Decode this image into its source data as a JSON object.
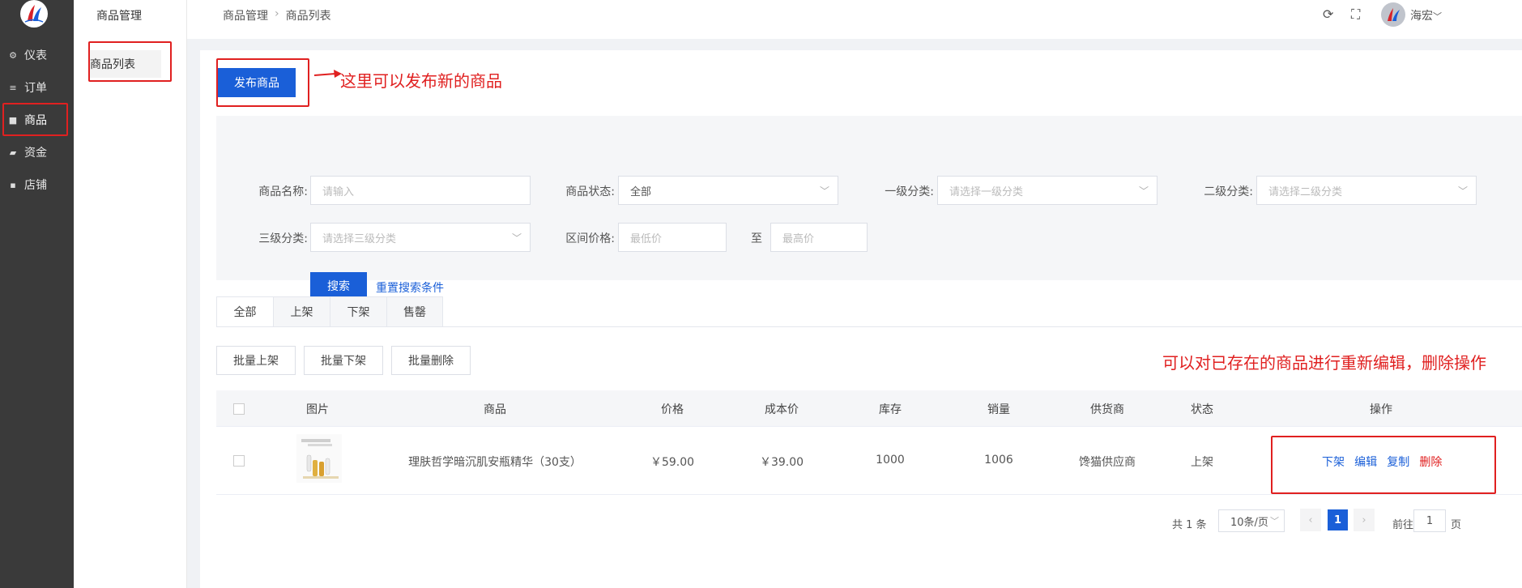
{
  "sidebar": {
    "items": [
      {
        "icon": "gear-icon",
        "label": "仪表"
      },
      {
        "icon": "list-icon",
        "label": "订单"
      },
      {
        "icon": "bag-icon",
        "label": "商品"
      },
      {
        "icon": "wallet-icon",
        "label": "资金"
      },
      {
        "icon": "store-icon",
        "label": "店铺"
      }
    ]
  },
  "submenu": {
    "title": "商品管理",
    "item": "商品列表"
  },
  "header": {
    "breadcrumb": [
      "商品管理",
      "商品列表"
    ],
    "username": "海宏"
  },
  "toolbar": {
    "publish_label": "发布商品"
  },
  "filters": {
    "name_label": "商品名称:",
    "name_placeholder": "请输入",
    "status_label": "商品状态:",
    "status_value": "全部",
    "cat1_label": "一级分类:",
    "cat1_placeholder": "请选择一级分类",
    "cat2_label": "二级分类:",
    "cat2_placeholder": "请选择二级分类",
    "cat3_label": "三级分类:",
    "cat3_placeholder": "请选择三级分类",
    "price_label": "区间价格:",
    "price_min_placeholder": "最低价",
    "price_to": "至",
    "price_max_placeholder": "最高价",
    "search_label": "搜索",
    "reset_label": "重置搜索条件"
  },
  "tabs": [
    "全部",
    "上架",
    "下架",
    "售罄"
  ],
  "bulk": {
    "on": "批量上架",
    "off": "批量下架",
    "delete": "批量删除"
  },
  "table": {
    "columns": [
      "图片",
      "商品",
      "价格",
      "成本价",
      "库存",
      "销量",
      "供货商",
      "状态",
      "操作"
    ],
    "rows": [
      {
        "name": "理肤哲学暗沉肌安瓶精华（30支）",
        "price": "￥59.00",
        "cost": "￥39.00",
        "stock": "1000",
        "sales": "1006",
        "supplier": "馋猫供应商",
        "status": "上架",
        "actions": {
          "off": "下架",
          "edit": "编辑",
          "copy": "复制",
          "delete": "删除"
        }
      }
    ]
  },
  "pagination": {
    "total": "共 1 条",
    "page_size": "10条/页",
    "current": "1",
    "goto_prefix": "前往",
    "goto_value": "1",
    "goto_suffix": "页"
  },
  "annotations": {
    "publish_note": "这里可以发布新的商品",
    "edit_note": "可以对已存在的商品进行重新编辑，删除操作"
  },
  "colors": {
    "primary": "#1a5fd8",
    "annotation": "#e02020",
    "sidebar": "#3a3a3a"
  }
}
